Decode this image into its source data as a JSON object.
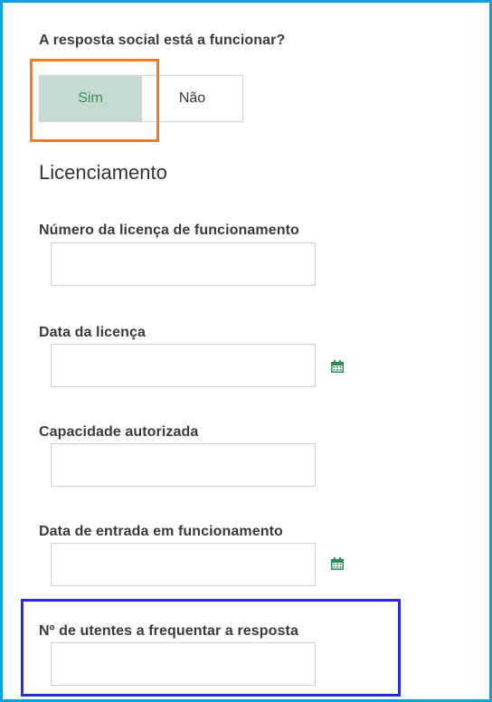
{
  "question": {
    "label": "A resposta social está a funcionar?",
    "options": [
      "Sim",
      "Não"
    ],
    "selected": "Sim"
  },
  "section": {
    "title": "Licenciamento"
  },
  "fields": {
    "license_number": {
      "label": "Número da licença de funcionamento",
      "value": ""
    },
    "license_date": {
      "label": "Data da licença",
      "value": ""
    },
    "authorized_capacity": {
      "label": "Capacidade autorizada",
      "value": ""
    },
    "start_date": {
      "label": "Data de entrada em funcionamento",
      "value": ""
    },
    "users_count": {
      "label": "Nº de utentes a frequentar a resposta",
      "value": ""
    }
  },
  "colors": {
    "accent_green": "#3a8a5a",
    "selected_bg": "#c5dad0",
    "frame_blue": "#0aa0dc",
    "highlight_orange": "#f27a1f",
    "highlight_blue": "#2a2ae6"
  },
  "icons": {
    "date_picker": "calendar-icon"
  }
}
